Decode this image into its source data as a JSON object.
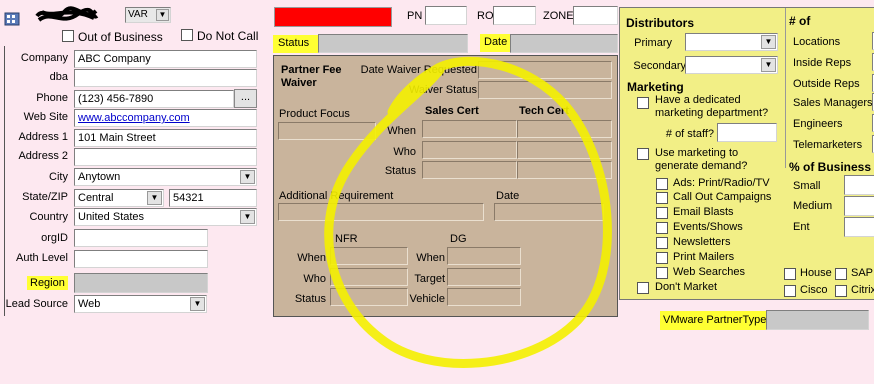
{
  "header": {
    "var_value": "VAR",
    "pn_label": "PN",
    "ro_label": "RO",
    "zone_label": "ZONE",
    "out_of_business_label": "Out of Business",
    "do_not_call_label": "Do Not Call",
    "status_label": "Status",
    "date_label": "Date",
    "alert_color": "#ff0000"
  },
  "company_form": {
    "company_label": "Company",
    "company_value": "ABC Company",
    "dba_label": "dba",
    "phone_label": "Phone",
    "phone_value": "(123) 456-7890",
    "website_label": "Web Site",
    "website_value": "www.abccompany.com",
    "address1_label": "Address 1",
    "address1_value": "101 Main Street",
    "address2_label": "Address 2",
    "city_label": "City",
    "city_value": "Anytown",
    "statezip_label": "State/ZIP",
    "state_value": "Central",
    "zip_value": "54321",
    "country_label": "Country",
    "country_value": "United States",
    "orgid_label": "orgID",
    "authlevel_label": "Auth Level",
    "region_label": "Region",
    "leadsource_label": "Lead Source",
    "leadsource_value": "Web",
    "ellipsis": "..."
  },
  "partner_panel": {
    "title_line1": "Partner Fee",
    "title_line2": "Waiver",
    "date_waiver_requested_label": "Date Waiver Requested",
    "waiver_status_label": "Waiver Status",
    "product_focus_label": "Product Focus",
    "sales_cert_label": "Sales Cert",
    "tech_cert_label": "Tech Cert",
    "when_label": "When",
    "who_label": "Who",
    "status_label": "Status",
    "additional_requirement_label": "Additional Requirement",
    "date_label": "Date",
    "nfr_label": "NFR",
    "dg_label": "DG",
    "nfr_when_label": "When",
    "nfr_who_label": "Who",
    "nfr_status_label": "Status",
    "dg_when_label": "When",
    "dg_target_label": "Target",
    "dg_vehicle_label": "Vehicle"
  },
  "distributors_panel": {
    "title": "Distributors",
    "primary_label": "Primary",
    "secondary_label": "Secondary",
    "marketing_title": "Marketing",
    "dedicated_line1": "Have a dedicated",
    "dedicated_line2": "marketing department?",
    "staff_label": "# of staff?",
    "use_marketing_line1": "Use marketing to",
    "use_marketing_line2": "generate demand?",
    "options": [
      "Ads: Print/Radio/TV",
      "Call Out Campaigns",
      "Email Blasts",
      "Events/Shows",
      "Newsletters",
      "Print Mailers",
      "Web Searches"
    ],
    "dont_market_label": "Don't Market"
  },
  "counts_panel": {
    "title": "# of",
    "items": [
      "Locations",
      "Inside Reps",
      "Outside Reps",
      "Sales Managers",
      "Engineers",
      "Telemarketers"
    ],
    "business_title": "% of Business i",
    "business_items": [
      "Small",
      "Medium",
      "Ent"
    ],
    "house_label": "House",
    "sap_label": "SAP",
    "cisco_label": "Cisco",
    "citrix_label": "Citrix"
  },
  "vmware": {
    "label": "VMware PartnerType"
  }
}
